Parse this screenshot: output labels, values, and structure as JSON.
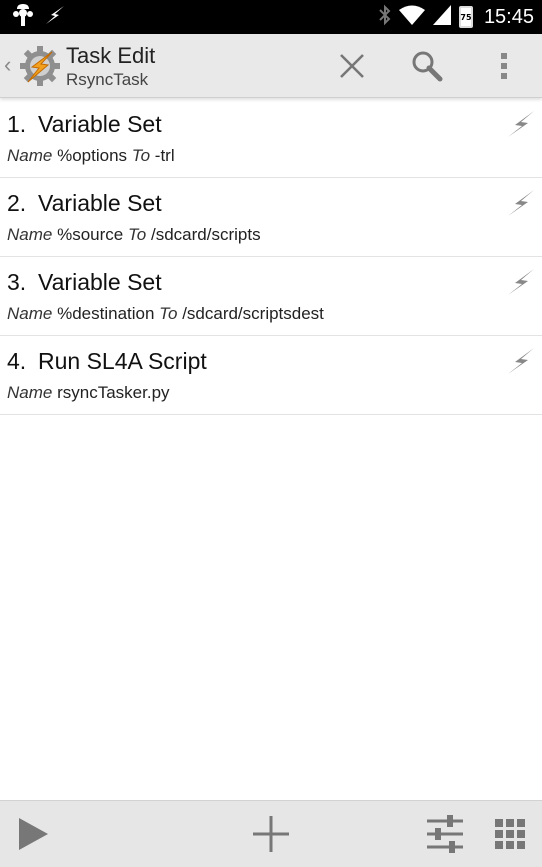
{
  "status_bar": {
    "time": "15:45",
    "battery_level": "75",
    "left_icons": [
      "android-debug-icon",
      "tasker-bolt-notification-icon"
    ],
    "right_icons": [
      "bluetooth-icon",
      "wifi-icon",
      "signal-icon",
      "battery-icon"
    ]
  },
  "action_bar": {
    "title": "Task Edit",
    "subtitle": "RsyncTask",
    "actions": [
      "close-icon",
      "search-icon",
      "overflow-menu-icon"
    ]
  },
  "actions_list": [
    {
      "number": "1.",
      "name": "Variable Set",
      "params": [
        {
          "key": "Name",
          "value": "%options"
        },
        {
          "key": "To",
          "value": "-trl"
        }
      ]
    },
    {
      "number": "2.",
      "name": "Variable Set",
      "params": [
        {
          "key": "Name",
          "value": "%source"
        },
        {
          "key": "To",
          "value": "/sdcard/scripts"
        }
      ]
    },
    {
      "number": "3.",
      "name": "Variable Set",
      "params": [
        {
          "key": "Name",
          "value": "%destination"
        },
        {
          "key": "To",
          "value": "/sdcard/scriptsdest"
        }
      ]
    },
    {
      "number": "4.",
      "name": "Run SL4A Script",
      "params": [
        {
          "key": "Name",
          "value": "rsyncTasker.py"
        }
      ]
    }
  ],
  "bottom_bar": {
    "buttons": [
      "play-icon",
      "add-icon",
      "settings-sliders-icon",
      "grid-icon"
    ]
  },
  "colors": {
    "status_bar_bg": "#000000",
    "action_bar_bg": "#e9e9e9",
    "bottom_bar_bg": "#e6e6e6",
    "icon_gray": "#777777"
  }
}
